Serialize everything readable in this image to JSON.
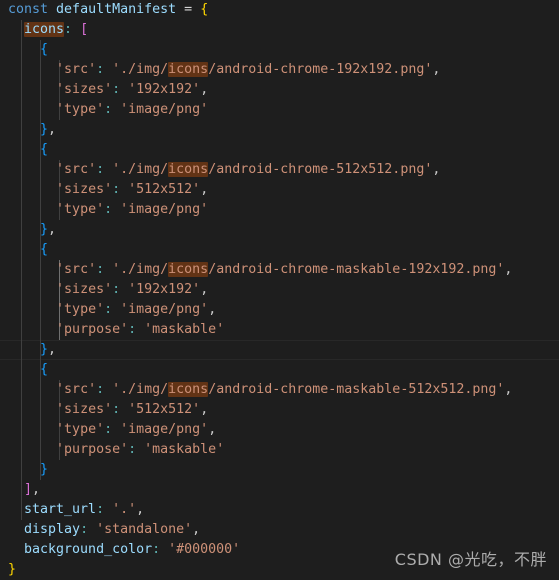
{
  "editor": {
    "background_color": "#1e1e1e",
    "default_text_color": "#d4d4d4",
    "language": "javascript",
    "search_highlight_term": "icons",
    "search_highlight_color": "#623315",
    "current_line_number": 18,
    "colors": {
      "keyword": "#569cd6",
      "identifier": "#9cdcfe",
      "string": "#ce9178",
      "punctuation": "#cccccc",
      "colon": "#5fb3b3",
      "bracket_yellow": "#ffd700",
      "bracket_pink": "#da70d6",
      "bracket_blue": "#179fff",
      "indent_guide": "#404040",
      "indent_guide_active": "#707070"
    }
  },
  "code": {
    "l1": {
      "kw": "const",
      "name": "defaultManifest",
      "op": "=",
      "brace": "{"
    },
    "l2": {
      "key": "icons",
      "colon": ":",
      "bracket": "["
    },
    "l3": {
      "brace": "{"
    },
    "l4": {
      "key": "'src'",
      "colon": ":",
      "pre": "'./img/",
      "hl": "icons",
      "post": "/android-chrome-192x192.png'",
      "comma": ","
    },
    "l5": {
      "key": "'sizes'",
      "colon": ":",
      "value": "'192x192'",
      "comma": ","
    },
    "l6": {
      "key": "'type'",
      "colon": ":",
      "value": "'image/png'"
    },
    "l7": {
      "brace": "}",
      "comma": ","
    },
    "l8": {
      "brace": "{"
    },
    "l9": {
      "key": "'src'",
      "colon": ":",
      "pre": "'./img/",
      "hl": "icons",
      "post": "/android-chrome-512x512.png'",
      "comma": ","
    },
    "l10": {
      "key": "'sizes'",
      "colon": ":",
      "value": "'512x512'",
      "comma": ","
    },
    "l11": {
      "key": "'type'",
      "colon": ":",
      "value": "'image/png'"
    },
    "l12": {
      "brace": "}",
      "comma": ","
    },
    "l13": {
      "brace": "{"
    },
    "l14": {
      "key": "'src'",
      "colon": ":",
      "pre": "'./img/",
      "hl": "icons",
      "post": "/android-chrome-maskable-192x192.png'",
      "comma": ","
    },
    "l15": {
      "key": "'sizes'",
      "colon": ":",
      "value": "'192x192'",
      "comma": ","
    },
    "l16": {
      "key": "'type'",
      "colon": ":",
      "value": "'image/png'",
      "comma": ","
    },
    "l17": {
      "key": "'purpose'",
      "colon": ":",
      "value": "'maskable'"
    },
    "l18": {
      "brace": "}",
      "comma": ","
    },
    "l19": {
      "brace": "{"
    },
    "l20": {
      "key": "'src'",
      "colon": ":",
      "pre": "'./img/",
      "hl": "icons",
      "post": "/android-chrome-maskable-512x512.png'",
      "comma": ","
    },
    "l21": {
      "key": "'sizes'",
      "colon": ":",
      "value": "'512x512'",
      "comma": ","
    },
    "l22": {
      "key": "'type'",
      "colon": ":",
      "value": "'image/png'",
      "comma": ","
    },
    "l23": {
      "key": "'purpose'",
      "colon": ":",
      "value": "'maskable'"
    },
    "l24": {
      "brace": "}"
    },
    "l25": {
      "bracket": "]",
      "comma": ","
    },
    "l26": {
      "key": "start_url",
      "colon": ":",
      "value": "'.'",
      "comma": ","
    },
    "l27": {
      "key": "display",
      "colon": ":",
      "value": "'standalone'",
      "comma": ","
    },
    "l28": {
      "key": "background_color",
      "colon": ":",
      "value": "'#000000'"
    },
    "l29": {
      "brace": "}"
    }
  },
  "watermark": {
    "text": "CSDN @光吃，不胖"
  }
}
